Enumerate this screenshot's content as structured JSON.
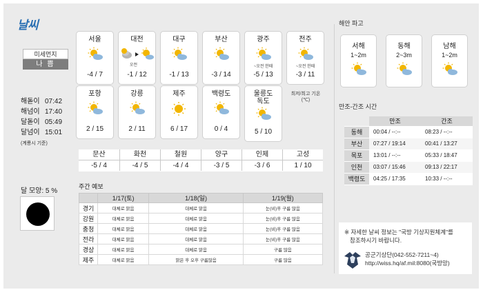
{
  "logo": "날씨",
  "dust": {
    "label": "미세먼지",
    "value": "나 쁨"
  },
  "sun_info": {
    "rows": [
      {
        "label": "해돋이",
        "time": "07:42"
      },
      {
        "label": "해넘이",
        "time": "17:40"
      },
      {
        "label": "달돋이",
        "time": "05:49"
      },
      {
        "label": "달넘이",
        "time": "15:01"
      }
    ],
    "note": "(계룡시 기준)"
  },
  "moon": {
    "label": "달 모양: 5 %",
    "phase_percent": 5
  },
  "cities": [
    {
      "name": "서울",
      "note": "",
      "temp": "-4 / 7",
      "icon": "sun-cloud-icon"
    },
    {
      "name": "대전",
      "note": "오전",
      "temp": "-1 / 12",
      "icon": "cloud-to-sun-icon"
    },
    {
      "name": "대구",
      "note": "",
      "temp": "-1 / 13",
      "icon": "sun-cloud-icon"
    },
    {
      "name": "부산",
      "note": "",
      "temp": "-3 / 14",
      "icon": "sun-cloud-icon"
    },
    {
      "name": "광주",
      "note": "~오전 한때",
      "temp": "-5 / 13",
      "icon": "sun-cloud-icon"
    },
    {
      "name": "전주",
      "note": "~오전 한때",
      "temp": "-3 / 11",
      "icon": "sun-cloud-icon"
    },
    {
      "name": "포항",
      "note": "",
      "temp": "2 / 15",
      "icon": "sun-cloud-icon"
    },
    {
      "name": "강릉",
      "note": "",
      "temp": "2 / 11",
      "icon": "sun-cloud-icon"
    },
    {
      "name": "제주",
      "note": "",
      "temp": "6 / 17",
      "icon": "sun-cloud-icon"
    },
    {
      "name": "백령도",
      "note": "",
      "temp": "0 / 4",
      "icon": "sun-cloud-icon"
    },
    {
      "name": "울릉도\n독도",
      "note": "",
      "temp": "5 / 10",
      "icon": "sun-cloud-icon"
    }
  ],
  "minmax_label": "최저/최고 기온\n(℃)",
  "regions": [
    {
      "name": "문산",
      "temp": "-5 / 4"
    },
    {
      "name": "화천",
      "temp": "-4 / 5"
    },
    {
      "name": "철원",
      "temp": "-4 / 4"
    },
    {
      "name": "양구",
      "temp": "-3 / 5"
    },
    {
      "name": "인제",
      "temp": "-3 / 6"
    },
    {
      "name": "고성",
      "temp": "1 / 10"
    }
  ],
  "weekly": {
    "title": "주간 예보",
    "dates": [
      "1/17(토)",
      "1/18(일)",
      "1/19(월)"
    ],
    "rows": [
      {
        "region": "경기",
        "f": [
          "대체로 맑음",
          "대체로 맑음",
          "눈(비)후 구름 많음"
        ]
      },
      {
        "region": "강원",
        "f": [
          "대체로 맑음",
          "대체로 맑음",
          "눈(비)후 구름 많음"
        ]
      },
      {
        "region": "충청",
        "f": [
          "대체로 맑음",
          "대체로 맑음",
          "눈(비)후 구름 많음"
        ]
      },
      {
        "region": "전라",
        "f": [
          "대체로 맑음",
          "대체로 맑음",
          "눈(비)후 구름 많음"
        ]
      },
      {
        "region": "경상",
        "f": [
          "대체로 맑음",
          "대체로 맑음",
          "구름 많음"
        ]
      },
      {
        "region": "제주",
        "f": [
          "대체로 맑음",
          "맑은 후 오후 구름많음",
          "구름 많음"
        ]
      }
    ]
  },
  "sea": {
    "title": "해안 파고",
    "items": [
      {
        "name": "서해",
        "wave": "1~2m"
      },
      {
        "name": "동해",
        "wave": "2~3m"
      },
      {
        "name": "남해",
        "wave": "1~2m"
      }
    ]
  },
  "tide": {
    "title": "만조-간조 시간",
    "headers": [
      "만조",
      "간조"
    ],
    "rows": [
      {
        "loc": "동해",
        "high": "00:04 / --:--",
        "low": "08:23 / --:--"
      },
      {
        "loc": "부산",
        "high": "07:27 / 19:14",
        "low": "00:41 / 13:27"
      },
      {
        "loc": "목포",
        "high": "13:01 / --:--",
        "low": "05:33 / 18:47"
      },
      {
        "loc": "인천",
        "high": "03:07 / 15:46",
        "low": "09:13 / 22:17"
      },
      {
        "loc": "백령도",
        "high": "04:25 / 17:35",
        "low": "10:33 / --:--"
      }
    ]
  },
  "info": {
    "line1": "※ 자세한 날씨 정보는 \"국방 기상지원체계\"를",
    "line2": "참조하시기 바랍니다.",
    "contact": "공군기상단(042-552-7211~4)",
    "url": "http://wiss.hq/af.mil:8080(국방망)"
  }
}
